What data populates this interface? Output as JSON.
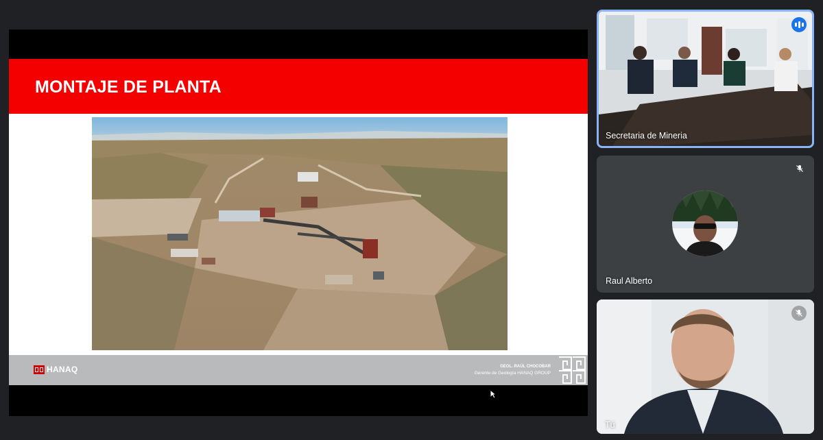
{
  "slide": {
    "title": "MONTAJE DE PLANTA",
    "brand": "HANAQ",
    "presenter_name": "GEOL. RAÚL CHOCOBAR",
    "presenter_role": "Gerente de Geología HANAQ GROUP"
  },
  "participants": [
    {
      "name": "Secretaria de Mineria",
      "state": "speaking",
      "icon": "audio-level-icon"
    },
    {
      "name": "Raul Alberto",
      "state": "muted",
      "icon": "mic-off-icon"
    },
    {
      "name": "Tú",
      "state": "muted",
      "icon": "mic-off-icon"
    }
  ],
  "colors": {
    "background": "#202124",
    "tile": "#3c4043",
    "active_speaker_border": "#8ab4f8",
    "speaking_badge": "#1a73e8",
    "slide_header": "#f50000",
    "slide_footer": "#b9babb"
  }
}
